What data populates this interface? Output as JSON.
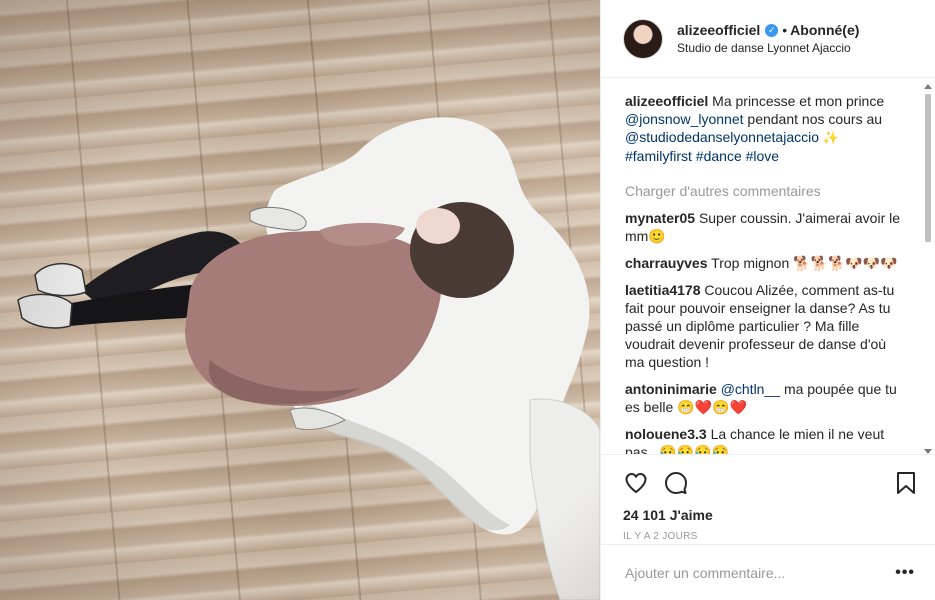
{
  "post": {
    "username": "alizeeofficiel",
    "verified_icon": "verified-badge-icon",
    "separator": "•",
    "follow_status": "Abonné(e)",
    "location": "Studio de danse Lyonnet Ajaccio"
  },
  "caption": {
    "username": "alizeeofficiel",
    "text_1": "Ma princesse et mon prince",
    "mention_1": "@jonsnow_lyonnet",
    "text_2": "pendant nos cours au",
    "mention_2": "@studiodedanselyonnetajaccio",
    "emoji": "✨",
    "tag_1": "#familyfirst",
    "tag_2": "#dance",
    "tag_3": "#love"
  },
  "load_more_label": "Charger d'autres commentaires",
  "comments": [
    {
      "user": "mynater05",
      "text": "Super coussin. J'aimerai avoir le mm🙂"
    },
    {
      "user": "charrauyves",
      "text": "Trop mignon 🐕🐕🐕🐶🐶🐶"
    },
    {
      "user": "laetitia4178",
      "text": "Coucou Alizée, comment as-tu fait pour pouvoir enseigner la danse? As tu passé un diplôme particulier ? Ma fille voudrait devenir professeur de danse d'où ma question !"
    },
    {
      "user": "antoninimarie",
      "mention": "@chtln__",
      "text": "ma poupée que tu es belle 😁❤️😁❤️"
    },
    {
      "user": "nolouene3.3",
      "text": "La chance le mien il ne veut pas...😥😥😥😥"
    }
  ],
  "actions": {
    "like_icon": "heart-icon",
    "comment_icon": "comment-bubble-icon",
    "save_icon": "bookmark-icon"
  },
  "likes": "24 101 J'aime",
  "timestamp": "IL Y A 2 JOURS",
  "add_comment": {
    "placeholder": "Ajouter un commentaire...",
    "more_label": "•••"
  },
  "colors": {
    "link": "#003569",
    "muted": "#999999",
    "verified": "#3897f0",
    "text": "#262626"
  }
}
